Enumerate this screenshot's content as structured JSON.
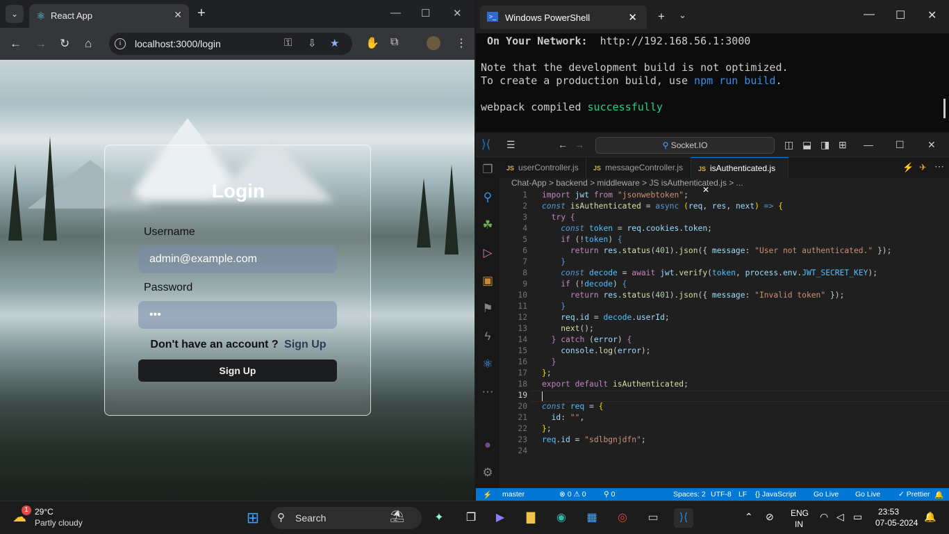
{
  "browser": {
    "tab_title": "React App",
    "new_tab": "+",
    "url": "localhost:3000/login",
    "win": {
      "min": "—",
      "max": "☐",
      "close": "✕"
    },
    "nav": {
      "back": "←",
      "forward": "→",
      "reload": "↻",
      "home": "⌂"
    },
    "menu": "⋮"
  },
  "login": {
    "title": "Login",
    "username_label": "Username",
    "username_value": "admin@example.com",
    "password_label": "Password",
    "password_value": "•••",
    "no_account": "Don't have an account ?",
    "signup_link": "Sign Up",
    "signup_button": "Sign Up"
  },
  "powershell": {
    "tab_title": "Windows PowerShell",
    "lines": {
      "network_label": " On Your Network:",
      "network_url": "  http://192.168.56.1:3000",
      "note": "Note that the development build is not optimized.",
      "create_prefix": "To create a production build, use ",
      "create_cmd": "npm run build",
      "create_suffix": ".",
      "compiled_prefix": "webpack compiled ",
      "compiled_status": "successfully"
    }
  },
  "vscode": {
    "search": "Socket.IO",
    "tabs": [
      "userController.js",
      "messageController.js",
      "isAuthenticated.js"
    ],
    "tab_badge": "JS",
    "breadcrumb": "Chat-App  >  backend  >  middleware  >  JS isAuthenticated.js  >  ...",
    "status": {
      "branch": "master",
      "errors": "⊗ 0 ⚠ 0",
      "ports": "⚲ 0",
      "spaces": "Spaces: 2",
      "encoding": "UTF-8",
      "eol": "LF",
      "lang": "{} JavaScript",
      "golive1": "Go Live",
      "golive2": "Go Live",
      "prettier": "✓ Prettier"
    }
  },
  "taskbar": {
    "weather_temp": "29°C",
    "weather_desc": "Partly cloudy",
    "weather_badge": "1",
    "search": "Search",
    "lang1": "ENG",
    "lang2": "IN",
    "time": "23:53",
    "date": "07-05-2024"
  }
}
